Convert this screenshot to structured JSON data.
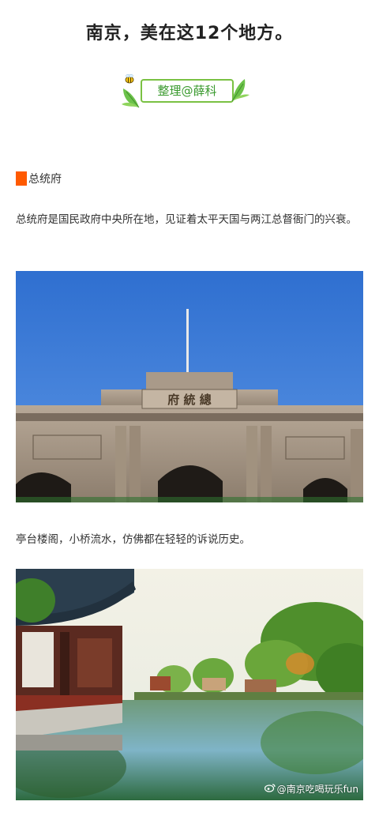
{
  "article": {
    "title": "南京，美在这12个地方。",
    "author_badge": "整理@薛科"
  },
  "section": {
    "heading": "总统府",
    "paragraph1": "总统府是国民政府中央所在地，见证着太平天国与两江总督衙门的兴衰。",
    "paragraph2": "亭台楼阁，小桥流水，仿佛都在轻轻的诉说历史。"
  },
  "photo1": {
    "plaque_text": "府 統 總"
  },
  "watermark": {
    "text": "@南京吃喝玩乐fun"
  },
  "colors": {
    "accent_orange": "#ff5a00",
    "badge_green": "#7ac143",
    "sky_blue": "#3f7fd8"
  }
}
